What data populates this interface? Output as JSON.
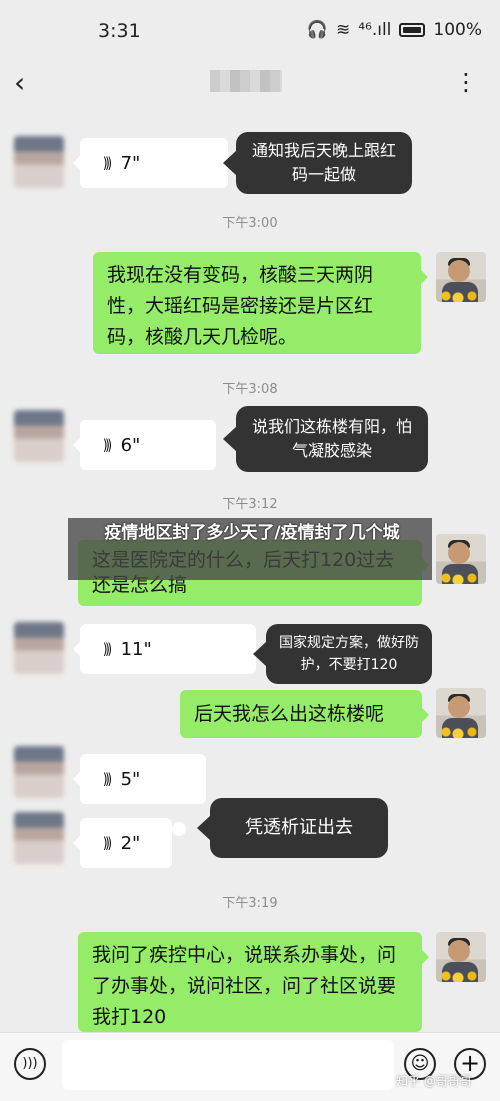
{
  "status_bar": {
    "time": "3:31",
    "signal_text": "⁴⁶.ıll",
    "battery_percent": "100%"
  },
  "header": {
    "back_icon": "‹",
    "more_icon": "⋮"
  },
  "messages": [
    {
      "type": "voice",
      "side": "left",
      "duration": "7\"",
      "transcript": "通知我后天晚上跟红码一起做"
    },
    {
      "type": "timestamp",
      "text": "下午3:00"
    },
    {
      "type": "text",
      "side": "right",
      "text": "我现在没有变码，核酸三天两阴性，大瑶红码是密接还是片区红码，核酸几天几检呢。"
    },
    {
      "type": "timestamp",
      "text": "下午3:08"
    },
    {
      "type": "voice",
      "side": "left",
      "duration": "6\"",
      "transcript": "说我们这栋楼有阳，怕气凝胶感染"
    },
    {
      "type": "timestamp",
      "text": "下午3:12"
    },
    {
      "type": "text",
      "side": "right",
      "text": "这是医院定的什么，后天打120过去还是怎么搞"
    },
    {
      "type": "voice",
      "side": "left",
      "duration": "11\"",
      "transcript": "国家规定方案，做好防护，不要打120"
    },
    {
      "type": "text",
      "side": "right",
      "text": "后天我怎么出这栋楼呢"
    },
    {
      "type": "voice",
      "side": "left",
      "duration": "5\""
    },
    {
      "type": "voice",
      "side": "left",
      "duration": "2\"",
      "transcript": "凭透析证出去"
    },
    {
      "type": "timestamp",
      "text": "下午3:19"
    },
    {
      "type": "text",
      "side": "right",
      "text": "我问了疾控中心，说联系办事处，问了办事处，说问社区，问了社区说要我打120"
    }
  ],
  "banner": {
    "headline": "疫情地区封了多少天了/疫情封了几个城"
  },
  "input_bar": {
    "watermark": "知乎 @哥哥哥"
  },
  "icons": [
    "back-icon",
    "more-icon",
    "voice-wave-icon",
    "voice-toggle-icon",
    "emoji-icon",
    "plus-icon",
    "battery-icon",
    "wifi-icon",
    "headphones-icon"
  ]
}
